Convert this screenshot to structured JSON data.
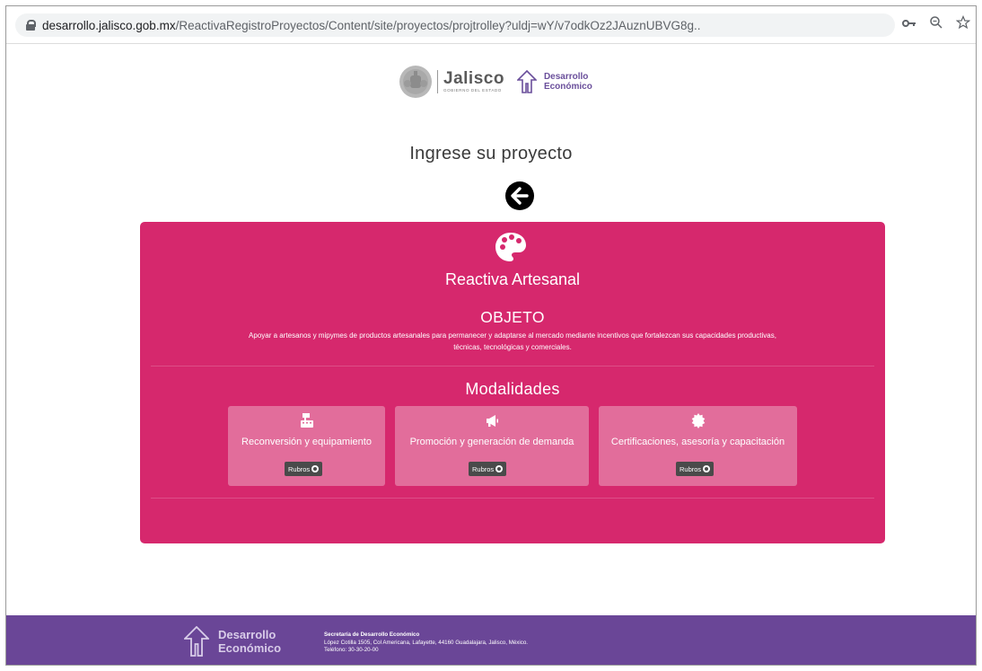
{
  "browser": {
    "url_host": "desarrollo.jalisco.gob.mx",
    "url_path": "/ReactivaRegistroProyectos/Content/site/proyectos/projtrolley?uldj=wY/v7odkOz2JAuznUBVG8g..",
    "icons": [
      "lock-icon",
      "key-icon",
      "zoom-icon",
      "star-icon"
    ]
  },
  "header": {
    "jalisco_logo_text": "Jalisco",
    "jalisco_logo_subtext": "GOBIERNO DEL ESTADO",
    "de_logo_line1": "Desarrollo",
    "de_logo_line2": "Económico"
  },
  "page_title": "Ingrese su proyecto",
  "card": {
    "title": "Reactiva Artesanal",
    "objeto_heading": "OBJETO",
    "objeto_text": "Apoyar a artesanos y mipymes de productos artesanales para permanecer y adaptarse al mercado mediante incentivos que fortalezcan sus capacidades productivas, técnicas, tecnológicas y comerciales.",
    "modalidades_heading": "Modalidades",
    "modalidades": [
      {
        "label": "Reconversión y equipamiento",
        "icon": "cash-register-icon",
        "button": "Rubros"
      },
      {
        "label": "Promoción y generación de demanda",
        "icon": "megaphone-icon",
        "button": "Rubros"
      },
      {
        "label": "Certificaciones, asesoría y capacitación",
        "icon": "certificate-icon",
        "button": "Rubros"
      }
    ]
  },
  "footer": {
    "logo_line1": "Desarrollo",
    "logo_line2": "Económico",
    "org": "Secretaría de Desarrollo Económico",
    "address": "López Cotilla 1505, Col Americana, Lafayette, 44160 Guadalajara, Jalisco, México.",
    "phone": "Teléfono: 30-30-20-00"
  },
  "colors": {
    "card_bg": "#d6286d",
    "modality_bg": "#e26d9b",
    "footer_bg": "#6a4697"
  }
}
